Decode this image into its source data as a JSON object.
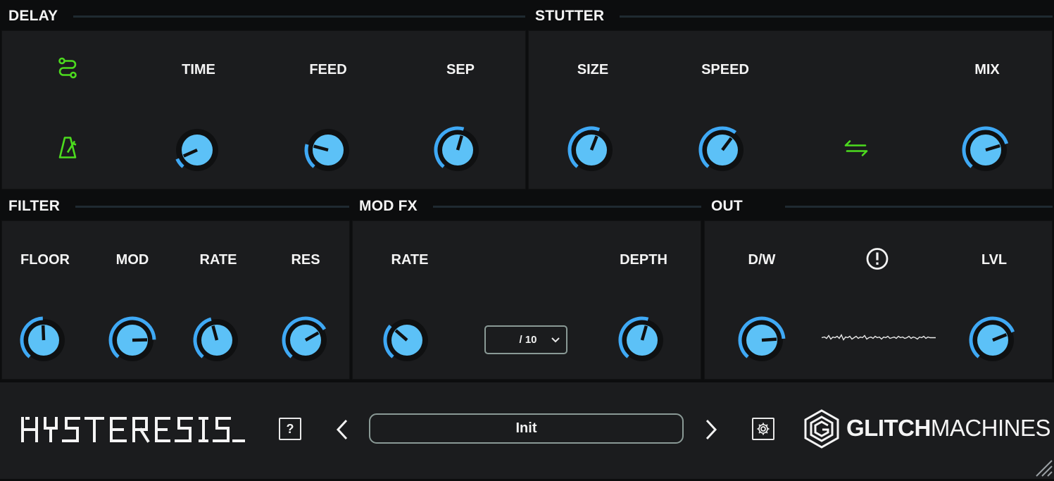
{
  "sections": {
    "delay": {
      "title": "DELAY"
    },
    "stutter": {
      "title": "STUTTER"
    },
    "filter": {
      "title": "FILTER"
    },
    "modfx": {
      "title": "MOD FX"
    },
    "out": {
      "title": "OUT"
    }
  },
  "delay": {
    "time_label": "TIME",
    "feed_label": "FEED",
    "sep_label": "SEP",
    "icons": [
      "route-icon",
      "metronome-icon"
    ],
    "knobs": {
      "time": 0.1,
      "feed": 0.25,
      "sep": 0.6
    }
  },
  "stutter": {
    "size_label": "SIZE",
    "speed_label": "SPEED",
    "mix_label": "MIX",
    "icons": [
      "swap-arrows-icon"
    ],
    "knobs": {
      "size": 0.62,
      "speed": 0.68,
      "mix": 0.82
    }
  },
  "filter": {
    "floor_label": "FLOOR",
    "mod_label": "MOD",
    "rate_label": "RATE",
    "res_label": "RES",
    "knobs": {
      "floor": 0.53,
      "mod": 0.88,
      "rate": 0.48,
      "res": 0.77
    }
  },
  "modfx": {
    "rate_label": "RATE",
    "depth_label": "DEPTH",
    "division_value": "/ 10",
    "knobs": {
      "rate": 0.35,
      "depth": 0.6
    }
  },
  "out": {
    "dw_label": "D/W",
    "lvl_label": "LVL",
    "icons": [
      "alert-icon",
      "waveform-icon"
    ],
    "knobs": {
      "dw": 0.87,
      "lvl": 0.8
    }
  },
  "footer": {
    "logo_text": "HYSTERESIS_",
    "help_label": "?",
    "preset_name": "Init",
    "brand_bold": "GLITCH",
    "brand_light": "MACHINES"
  },
  "colors": {
    "accent": "#3fa9f5",
    "knob_fill": "#5cc1f7",
    "green": "#4cdb1e",
    "panel": "#1b1c1e",
    "background": "#0c0d0e"
  }
}
